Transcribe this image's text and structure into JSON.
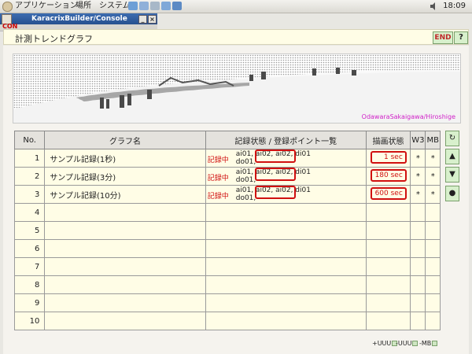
{
  "top_panel": {
    "menus": [
      "アプリケーション",
      "場所",
      "システム"
    ],
    "clock": "18:09"
  },
  "window": {
    "title": "KaracrixBuilder/Console",
    "con_label": "CON"
  },
  "app": {
    "title": "計測トレンドグラフ",
    "end_label": "END",
    "help_label": "?"
  },
  "banner": {
    "caption": "OdawaraSakaigawa/Hiroshige"
  },
  "table": {
    "headers": {
      "no": "No.",
      "name": "グラフ名",
      "points": "記録状態 / 登録ポイント一覧",
      "rate": "描画状態",
      "w3": "W3",
      "mb": "MB"
    },
    "rows": [
      {
        "no": "1",
        "name": "サンプル記録(1秒)",
        "status": "記録中",
        "points": "ai01, ai02, ai02, di01\ndo01,",
        "rate": "1 sec",
        "w3": "*",
        "mb": "*"
      },
      {
        "no": "2",
        "name": "サンプル記録(3分)",
        "status": "記録中",
        "points": "ai01, ai02, ai02, di01\ndo01,",
        "rate": "180 sec",
        "w3": "*",
        "mb": "*"
      },
      {
        "no": "3",
        "name": "サンプル記録(10分)",
        "status": "記録中",
        "points": "ai01, ai02, ai02, di01\ndo01,",
        "rate": "600 sec",
        "w3": "*",
        "mb": "*"
      },
      {
        "no": "4",
        "name": "",
        "status": "",
        "points": "",
        "rate": "",
        "w3": "",
        "mb": ""
      },
      {
        "no": "5",
        "name": "",
        "status": "",
        "points": "",
        "rate": "",
        "w3": "",
        "mb": ""
      },
      {
        "no": "6",
        "name": "",
        "status": "",
        "points": "",
        "rate": "",
        "w3": "",
        "mb": ""
      },
      {
        "no": "7",
        "name": "",
        "status": "",
        "points": "",
        "rate": "",
        "w3": "",
        "mb": ""
      },
      {
        "no": "8",
        "name": "",
        "status": "",
        "points": "",
        "rate": "",
        "w3": "",
        "mb": ""
      },
      {
        "no": "9",
        "name": "",
        "status": "",
        "points": "",
        "rate": "",
        "w3": "",
        "mb": ""
      },
      {
        "no": "10",
        "name": "",
        "status": "",
        "points": "",
        "rate": "",
        "w3": "",
        "mb": ""
      }
    ]
  },
  "side_buttons": {
    "refresh_icon": "↻",
    "up_icon": "▲",
    "down_icon": "▼",
    "dot_icon": "●"
  },
  "footer": {
    "uuu_plus": "+UUU",
    "uuu_minus": "-UUU",
    "mb_minus": "-MB"
  },
  "colors": {
    "accent_red": "#d01010",
    "button_green": "#d8f0cc",
    "row_bg": "#fffde6"
  }
}
